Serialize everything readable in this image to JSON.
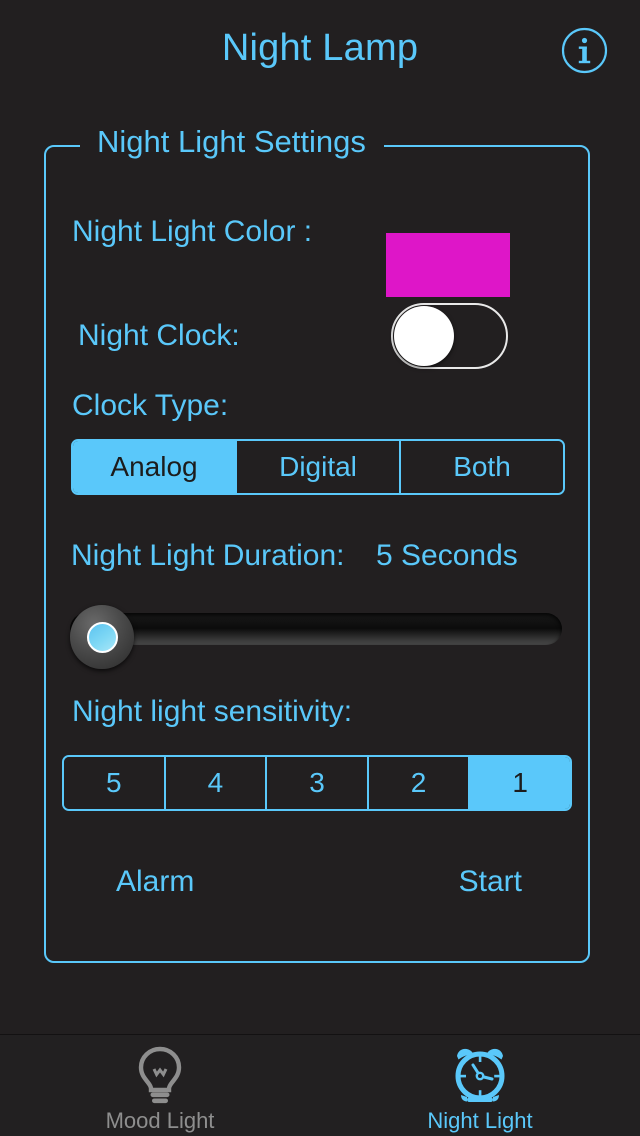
{
  "header": {
    "title": "Night Lamp",
    "info_icon": "info-circle-icon"
  },
  "panel": {
    "legend": "Night Light Settings",
    "border_color": "#5ac8fa",
    "color_row": {
      "label": "Night Light Color :",
      "swatch_color": "#de16c8"
    },
    "clock_row": {
      "label": "Night Clock:",
      "toggle_state": "off"
    },
    "clock_type": {
      "label": "Clock Type:",
      "options": [
        "Analog",
        "Digital",
        "Both"
      ],
      "selected": "Analog"
    },
    "duration": {
      "label": "Night Light Duration:",
      "value": "5 Seconds",
      "slider_position_percent": 0
    },
    "sensitivity": {
      "label": "Night light sensitivity:",
      "options": [
        "5",
        "4",
        "3",
        "2",
        "1"
      ],
      "selected": "1"
    },
    "actions": {
      "alarm_label": "Alarm",
      "start_label": "Start"
    }
  },
  "tabbar": {
    "tabs": [
      {
        "label": "Mood Light",
        "icon": "lightbulb-icon",
        "active": false,
        "color": "#8e8e8e"
      },
      {
        "label": "Night Light",
        "icon": "alarm-clock-icon",
        "active": true,
        "color": "#5ac8fa"
      }
    ]
  },
  "theme": {
    "background": "#221f20",
    "accent": "#5ac8fa"
  }
}
